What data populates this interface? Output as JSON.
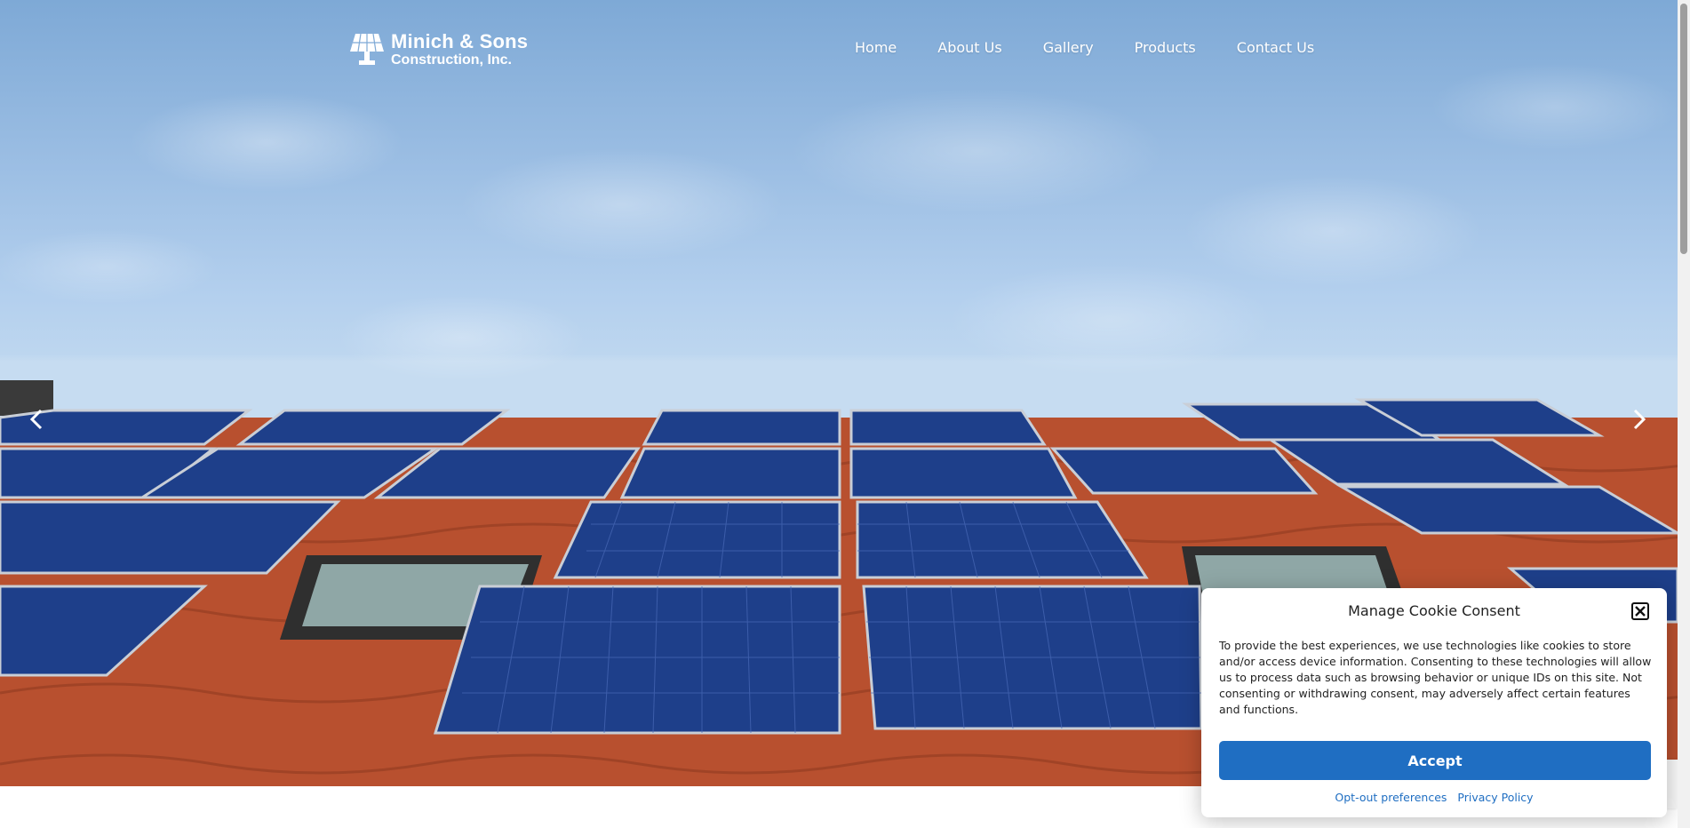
{
  "brand": {
    "line1": "Minich & Sons",
    "line2": "Construction, Inc."
  },
  "nav": [
    {
      "label": "Home"
    },
    {
      "label": "About Us"
    },
    {
      "label": "Gallery"
    },
    {
      "label": "Products"
    },
    {
      "label": "Contact Us"
    }
  ],
  "slider": {
    "prev_icon": "chevron-left-icon",
    "next_icon": "chevron-right-icon"
  },
  "cookie": {
    "title": "Manage Cookie Consent",
    "body": "To provide the best experiences, we use technologies like cookies to store and/or access device information. Consenting to these technologies will allow us to process data such as browsing behavior or unique IDs on this site. Not consenting or withdrawing consent, may adversely affect certain features and functions.",
    "accept_label": "Accept",
    "optout_label": "Opt-out preferences",
    "privacy_label": "Privacy Policy"
  },
  "colors": {
    "accent": "#1f6ec2",
    "panel": "#1e3f8a",
    "tile": "#c0532f"
  }
}
